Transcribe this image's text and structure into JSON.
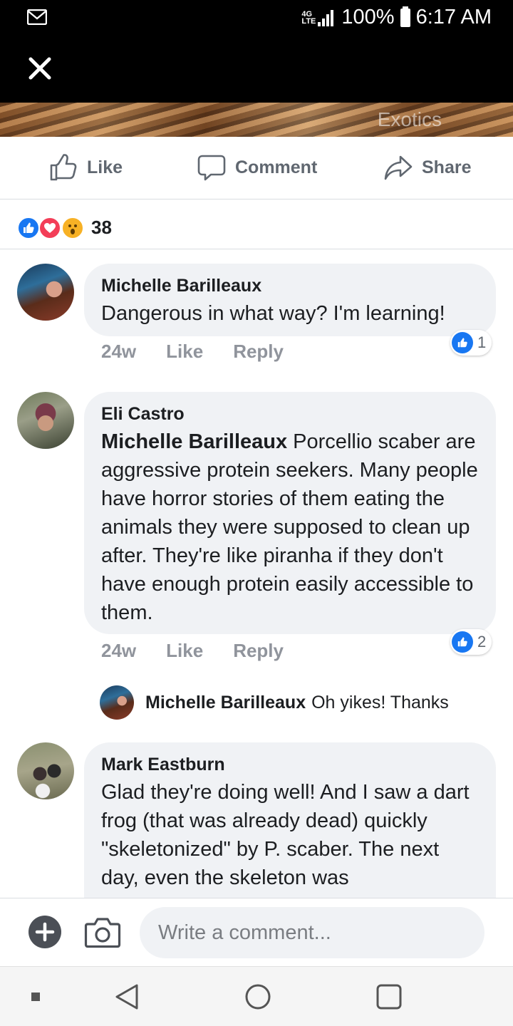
{
  "status_bar": {
    "network": "4G LTE",
    "battery": "100%",
    "time": "6:17 AM"
  },
  "photo": {
    "watermark": "Exotics"
  },
  "actions": {
    "like": "Like",
    "comment": "Comment",
    "share": "Share"
  },
  "reactions": {
    "types": [
      "like",
      "love",
      "wow"
    ],
    "count": "38"
  },
  "comments": [
    {
      "name": "Michelle Barilleaux",
      "text": "Dangerous in what way? I'm learning!",
      "time": "24w",
      "like_label": "Like",
      "reply_label": "Reply",
      "likes": "1"
    },
    {
      "name": "Eli Castro",
      "mention": "Michelle Barilleaux",
      "text": " Porcellio scaber are aggressive protein seekers. Many people have horror stories of them eating the animals they were supposed to clean up after. They're like piranha if they don't have enough protein easily accessible to them.",
      "time": "24w",
      "like_label": "Like",
      "reply_label": "Reply",
      "likes": "2",
      "reply": {
        "name": "Michelle Barilleaux",
        "text": "Oh yikes! Thanks"
      }
    },
    {
      "name": "Mark Eastburn",
      "text": "Glad they're doing well! And I saw a dart frog (that was already dead) quickly \"skeletonized\" by P. scaber. The next day, even the skeleton was"
    }
  ],
  "composer": {
    "placeholder": "Write a comment..."
  },
  "colors": {
    "facebook_blue": "#1877f2",
    "love_red": "#f33e58",
    "wow_yellow": "#f7b125",
    "meta_gray": "#90949c"
  }
}
